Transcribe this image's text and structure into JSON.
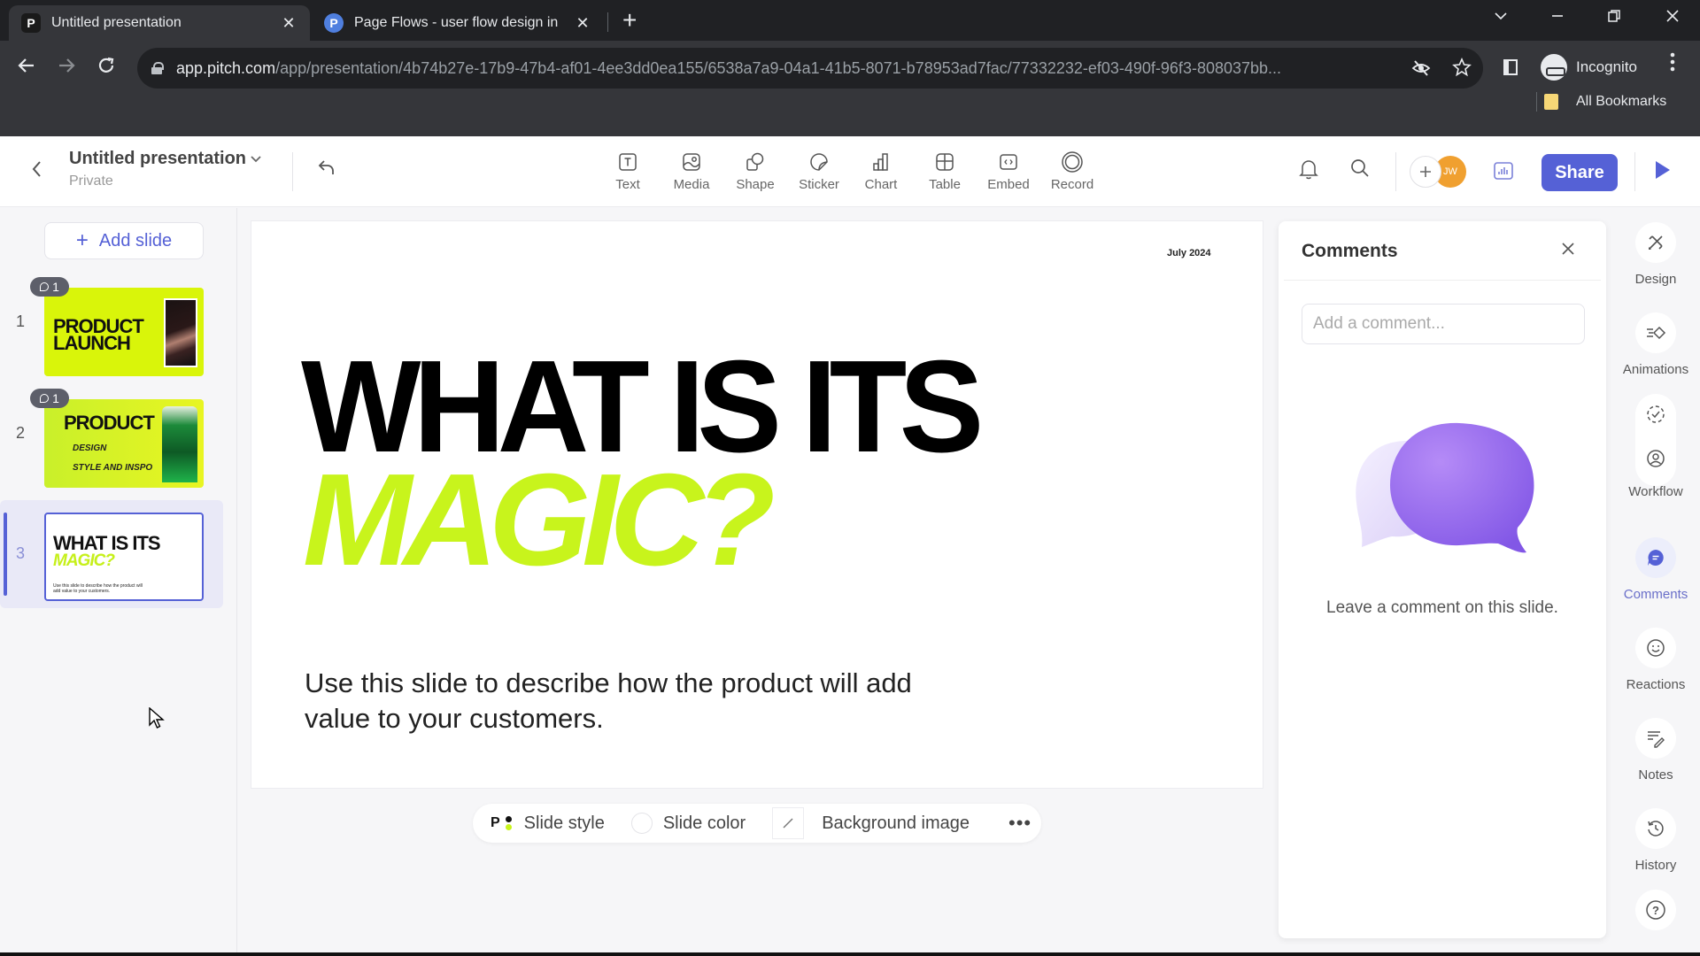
{
  "browser": {
    "tabs": [
      {
        "title": "Untitled presentation",
        "favicon": "pitch-logo-icon",
        "active": true
      },
      {
        "title": "Page Flows - user flow design in",
        "favicon": "page-flows-icon",
        "active": false
      }
    ],
    "favicon_letters": {
      "pitch": "P",
      "pageflows": "P"
    },
    "close_glyph": "✕",
    "new_tab_glyph": "+",
    "url_host": "app.pitch.com",
    "url_path": "/app/presentation/4b74b27e-17b9-47b4-af01-4ee3dd0ea155/6538a7a9-04a1-41b5-8071-b78953ad7fac/77332232-ef03-490f-96f3-808037bb...",
    "profile_label": "Incognito",
    "bookmarks_label": "All Bookmarks"
  },
  "app": {
    "title": "Untitled presentation",
    "visibility": "Private",
    "insert_tools": [
      {
        "label": "Text",
        "icon": "text-icon"
      },
      {
        "label": "Media",
        "icon": "media-icon"
      },
      {
        "label": "Shape",
        "icon": "shape-icon"
      },
      {
        "label": "Sticker",
        "icon": "sticker-icon"
      },
      {
        "label": "Chart",
        "icon": "chart-icon"
      },
      {
        "label": "Table",
        "icon": "table-icon"
      },
      {
        "label": "Embed",
        "icon": "embed-icon"
      },
      {
        "label": "Record",
        "icon": "record-icon"
      }
    ],
    "collaborator_initials": "JW",
    "share_label": "Share",
    "accent_color": "#5561d6",
    "brand_lime": "#c8f41c"
  },
  "slides_panel": {
    "add_slide_label": "Add slide",
    "slides": [
      {
        "number": "1",
        "comment_count": "1",
        "title": "PRODUCT LAUNCH",
        "selected": false
      },
      {
        "number": "2",
        "comment_count": "1",
        "title": "PRODUCT",
        "sub1": "DESIGN",
        "sub2": "STYLE AND INSPO",
        "selected": false
      },
      {
        "number": "3",
        "title": "WHAT IS ITS",
        "title_accent": "MAGIC?",
        "body": "Use this slide to describe how the product will add value to your customers.",
        "selected": true
      }
    ]
  },
  "slide": {
    "date": "July 2024",
    "title_line1": "WHAT IS ITS",
    "title_line2": "MAGIC?",
    "body": "Use this slide to describe how the product will add value to your customers."
  },
  "style_bar": {
    "slide_style_label": "Slide style",
    "style_letter": "P",
    "slide_color_label": "Slide color",
    "background_image_label": "Background image",
    "more_glyph": "•••"
  },
  "comments": {
    "title": "Comments",
    "input_placeholder": "Add a comment...",
    "input_value": "",
    "empty_message": "Leave a comment on this slide."
  },
  "right_rail": {
    "items": [
      {
        "label": "Design",
        "icon": "design-icon"
      },
      {
        "label": "Animations",
        "icon": "animations-icon"
      },
      {
        "label": "Workflow",
        "icon": "workflow-icon"
      },
      {
        "label": "Comments",
        "icon": "comments-icon",
        "active": true
      },
      {
        "label": "Reactions",
        "icon": "reactions-icon"
      },
      {
        "label": "Notes",
        "icon": "notes-icon"
      },
      {
        "label": "History",
        "icon": "history-icon"
      }
    ],
    "help_glyph": "?"
  }
}
